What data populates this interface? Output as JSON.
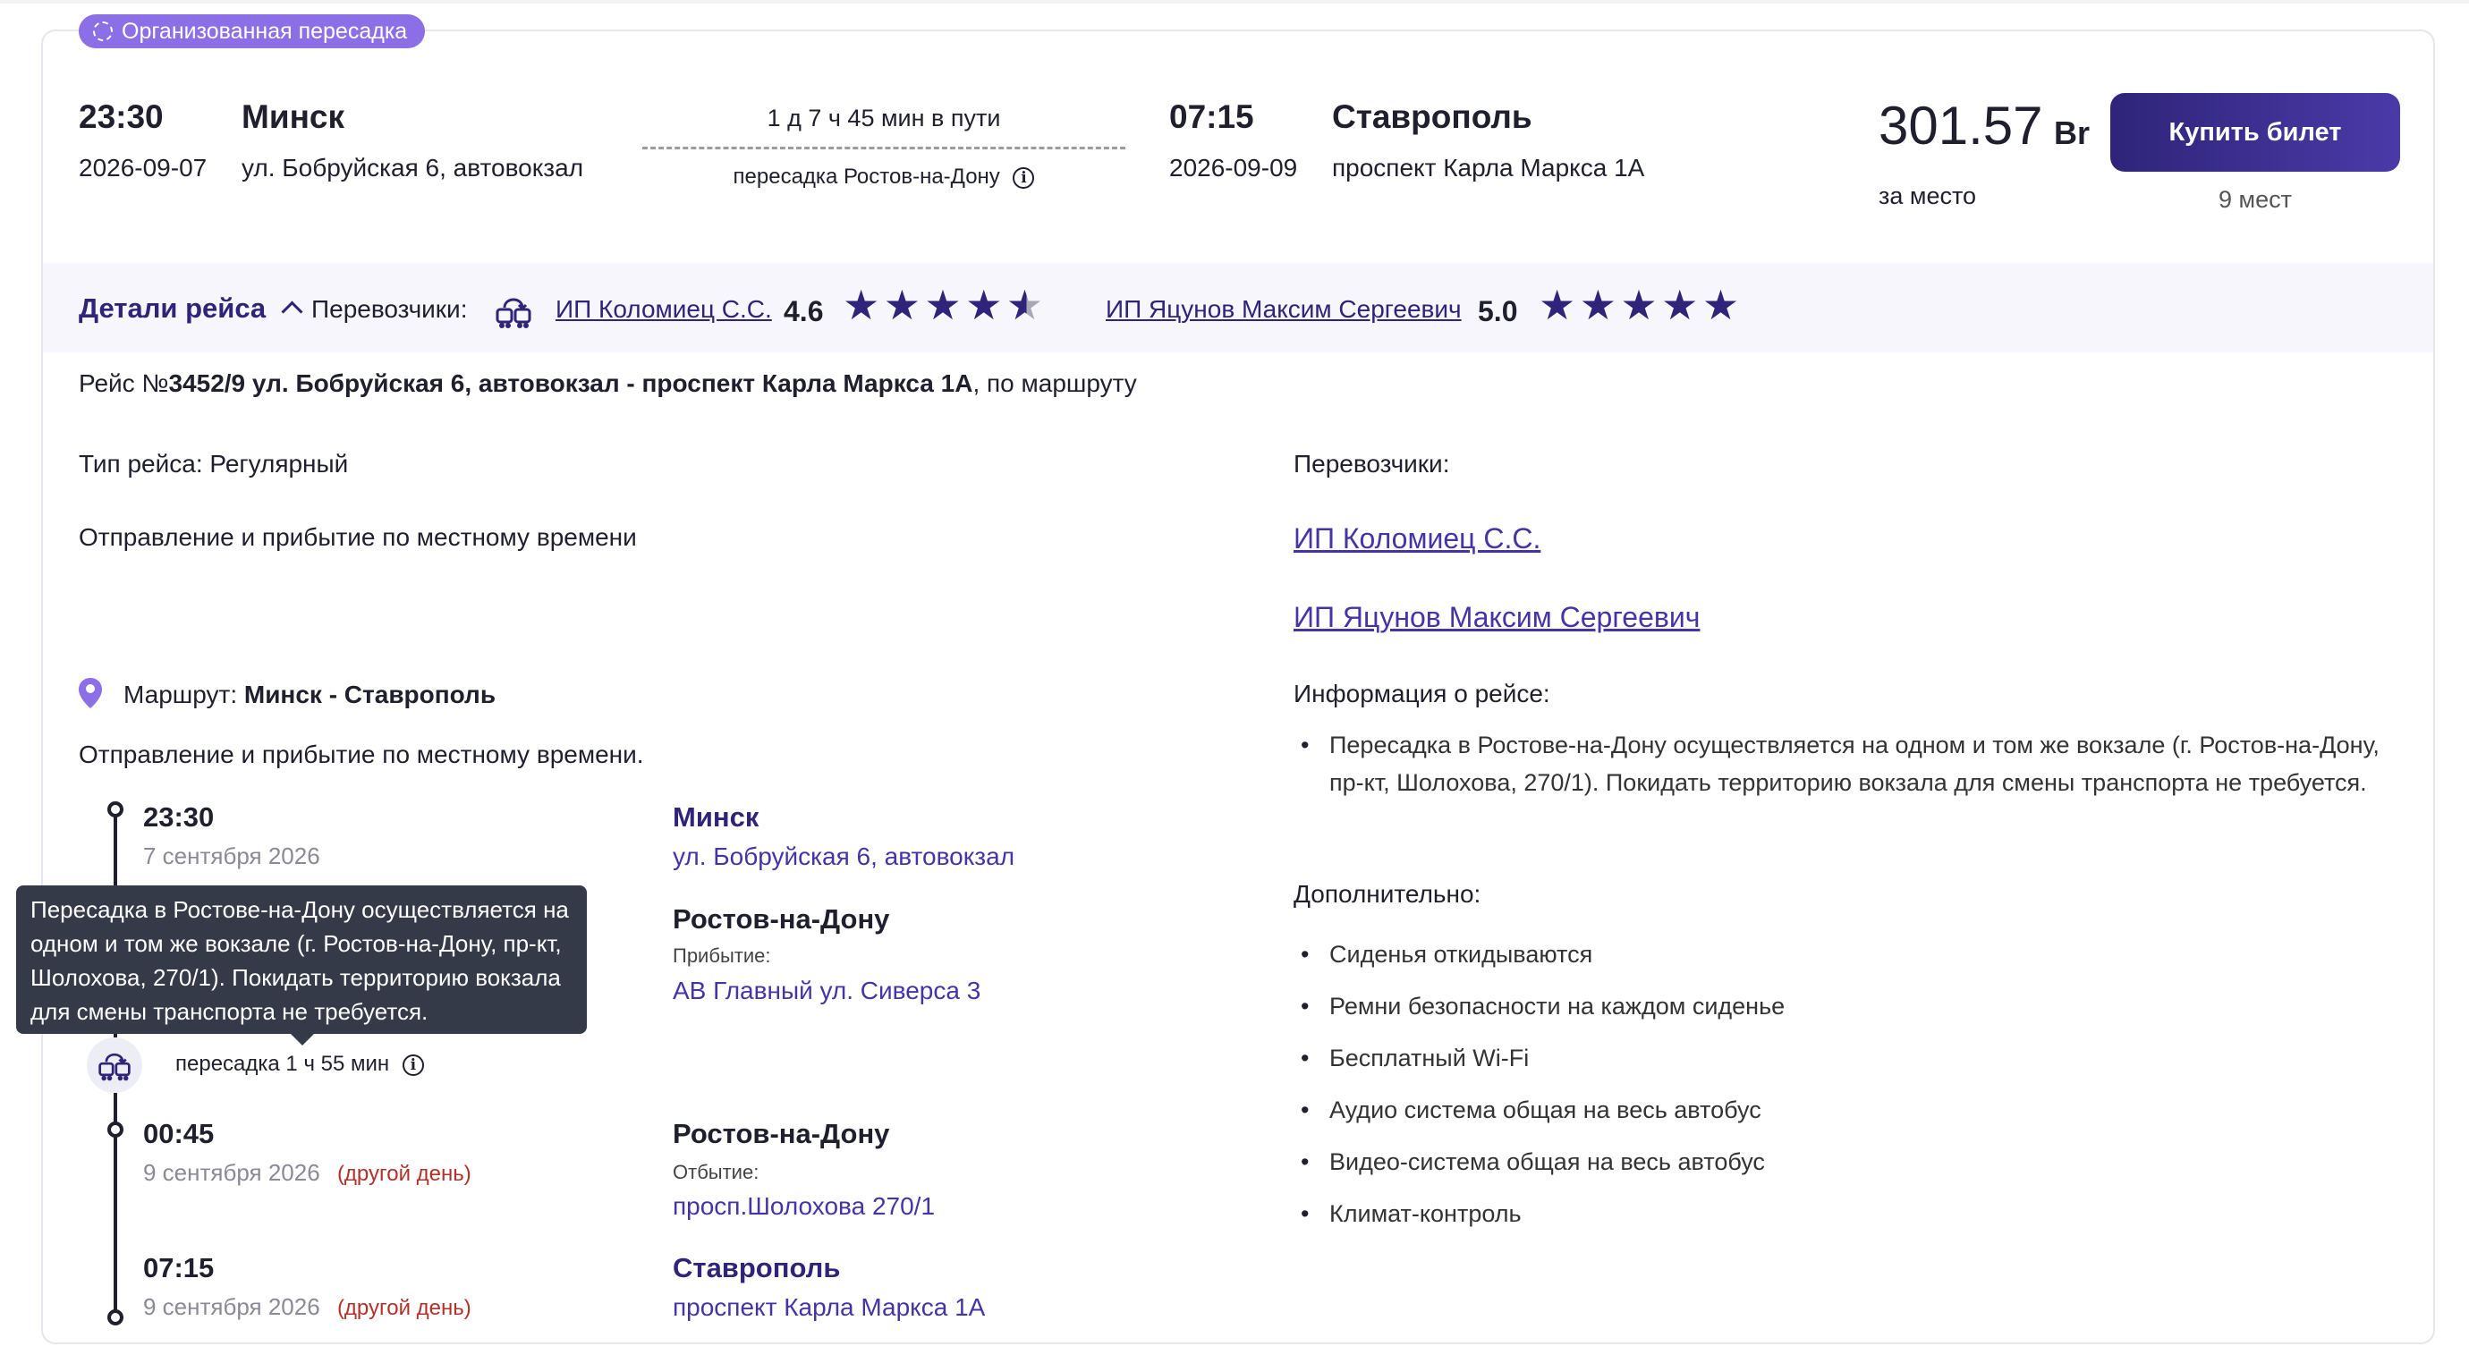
{
  "badge": {
    "label": "Организованная пересадка"
  },
  "trip": {
    "dep_time": "23:30",
    "dep_date": "2026-09-07",
    "dep_city": "Минск",
    "dep_addr": "ул. Бобруйская 6, автовокзал",
    "duration": "1 д 7 ч 45 мин в пути",
    "transfer": "пересадка Ростов-на-Дону",
    "arr_time": "07:15",
    "arr_date": "2026-09-09",
    "arr_city": "Ставрополь",
    "arr_addr": "проспект Карла Маркса 1А",
    "price": "301.57",
    "currency": "Br",
    "price_note": "за место",
    "buy_label": "Купить билет",
    "seats": "9 мест"
  },
  "details": {
    "toggle_label": "Детали рейса",
    "carriers_label": "Перевозчики:",
    "carriers": [
      {
        "name": "ИП Коломиец С.С.",
        "rating": "4.6",
        "stars": 4.6
      },
      {
        "name": "ИП Яцунов Максим Сергеевич",
        "rating": "5.0",
        "stars": 5.0
      }
    ]
  },
  "route": {
    "line_prefix": "Рейс №",
    "line_bold": "3452/9 ул. Бобруйская 6, автовокзал - проспект Карла Маркса 1А",
    "line_suffix": ", по маршруту",
    "type": "Тип рейса: Регулярный",
    "local_time": "Отправление и прибытие по местному времени",
    "route_label": "Маршрут: ",
    "route_value": "Минск - Ставрополь",
    "local_time2": "Отправление и прибытие по местному времени."
  },
  "timeline": {
    "stop1": {
      "time": "23:30",
      "date": "7 сентября 2026",
      "city": "Минск",
      "addr": "ул. Бобруйская 6, автовокзал"
    },
    "stop2": {
      "city": "Ростов-на-Дону",
      "label": "Прибытие:",
      "addr": "АВ Главный ул. Сиверса 3"
    },
    "transfer": "пересадка 1 ч 55 мин",
    "stop3": {
      "time": "00:45",
      "date": "9 сентября 2026",
      "other_day": "(другой день)",
      "city": "Ростов-на-Дону",
      "label": "Отбытие:",
      "addr": "просп.Шолохова 270/1"
    },
    "stop4": {
      "time": "07:15",
      "date": "9 сентября 2026",
      "other_day": "(другой день)",
      "city": "Ставрополь",
      "addr": "проспект Карла Маркса 1А"
    }
  },
  "tooltip": "Пересадка в Ростове-на-Дону осуществляется на одном и том же вокзале (г. Ростов-на-Дону, пр-кт, Шолохова, 270/1). Покидать территорию вокзала для смены транспорта не требуется.",
  "right": {
    "carriers_label": "Перевозчики:",
    "carrier1": "ИП Коломиец С.С.",
    "carrier2": "ИП Яцунов Максим Сергеевич",
    "info_label": "Информация о рейсе:",
    "info_item": "Пересадка в Ростове-на-Дону осуществляется на одном и том же вокзале (г. Ростов-на-Дону, пр-кт, Шолохова, 270/1). Покидать территорию вокзала для смены транспорта не требуется.",
    "extra_label": "Дополнительно:",
    "extras": [
      "Сиденья откидываются",
      "Ремни безопасности на каждом сиденье",
      "Бесплатный Wi-Fi",
      "Аудио система общая на весь автобус",
      "Видео-система общая на весь автобус",
      "Климат-контроль"
    ]
  },
  "colors": {
    "accent": "#2f2479",
    "badge": "#8c6ee6",
    "link": "#4634a6",
    "warning": "#b3312b"
  }
}
